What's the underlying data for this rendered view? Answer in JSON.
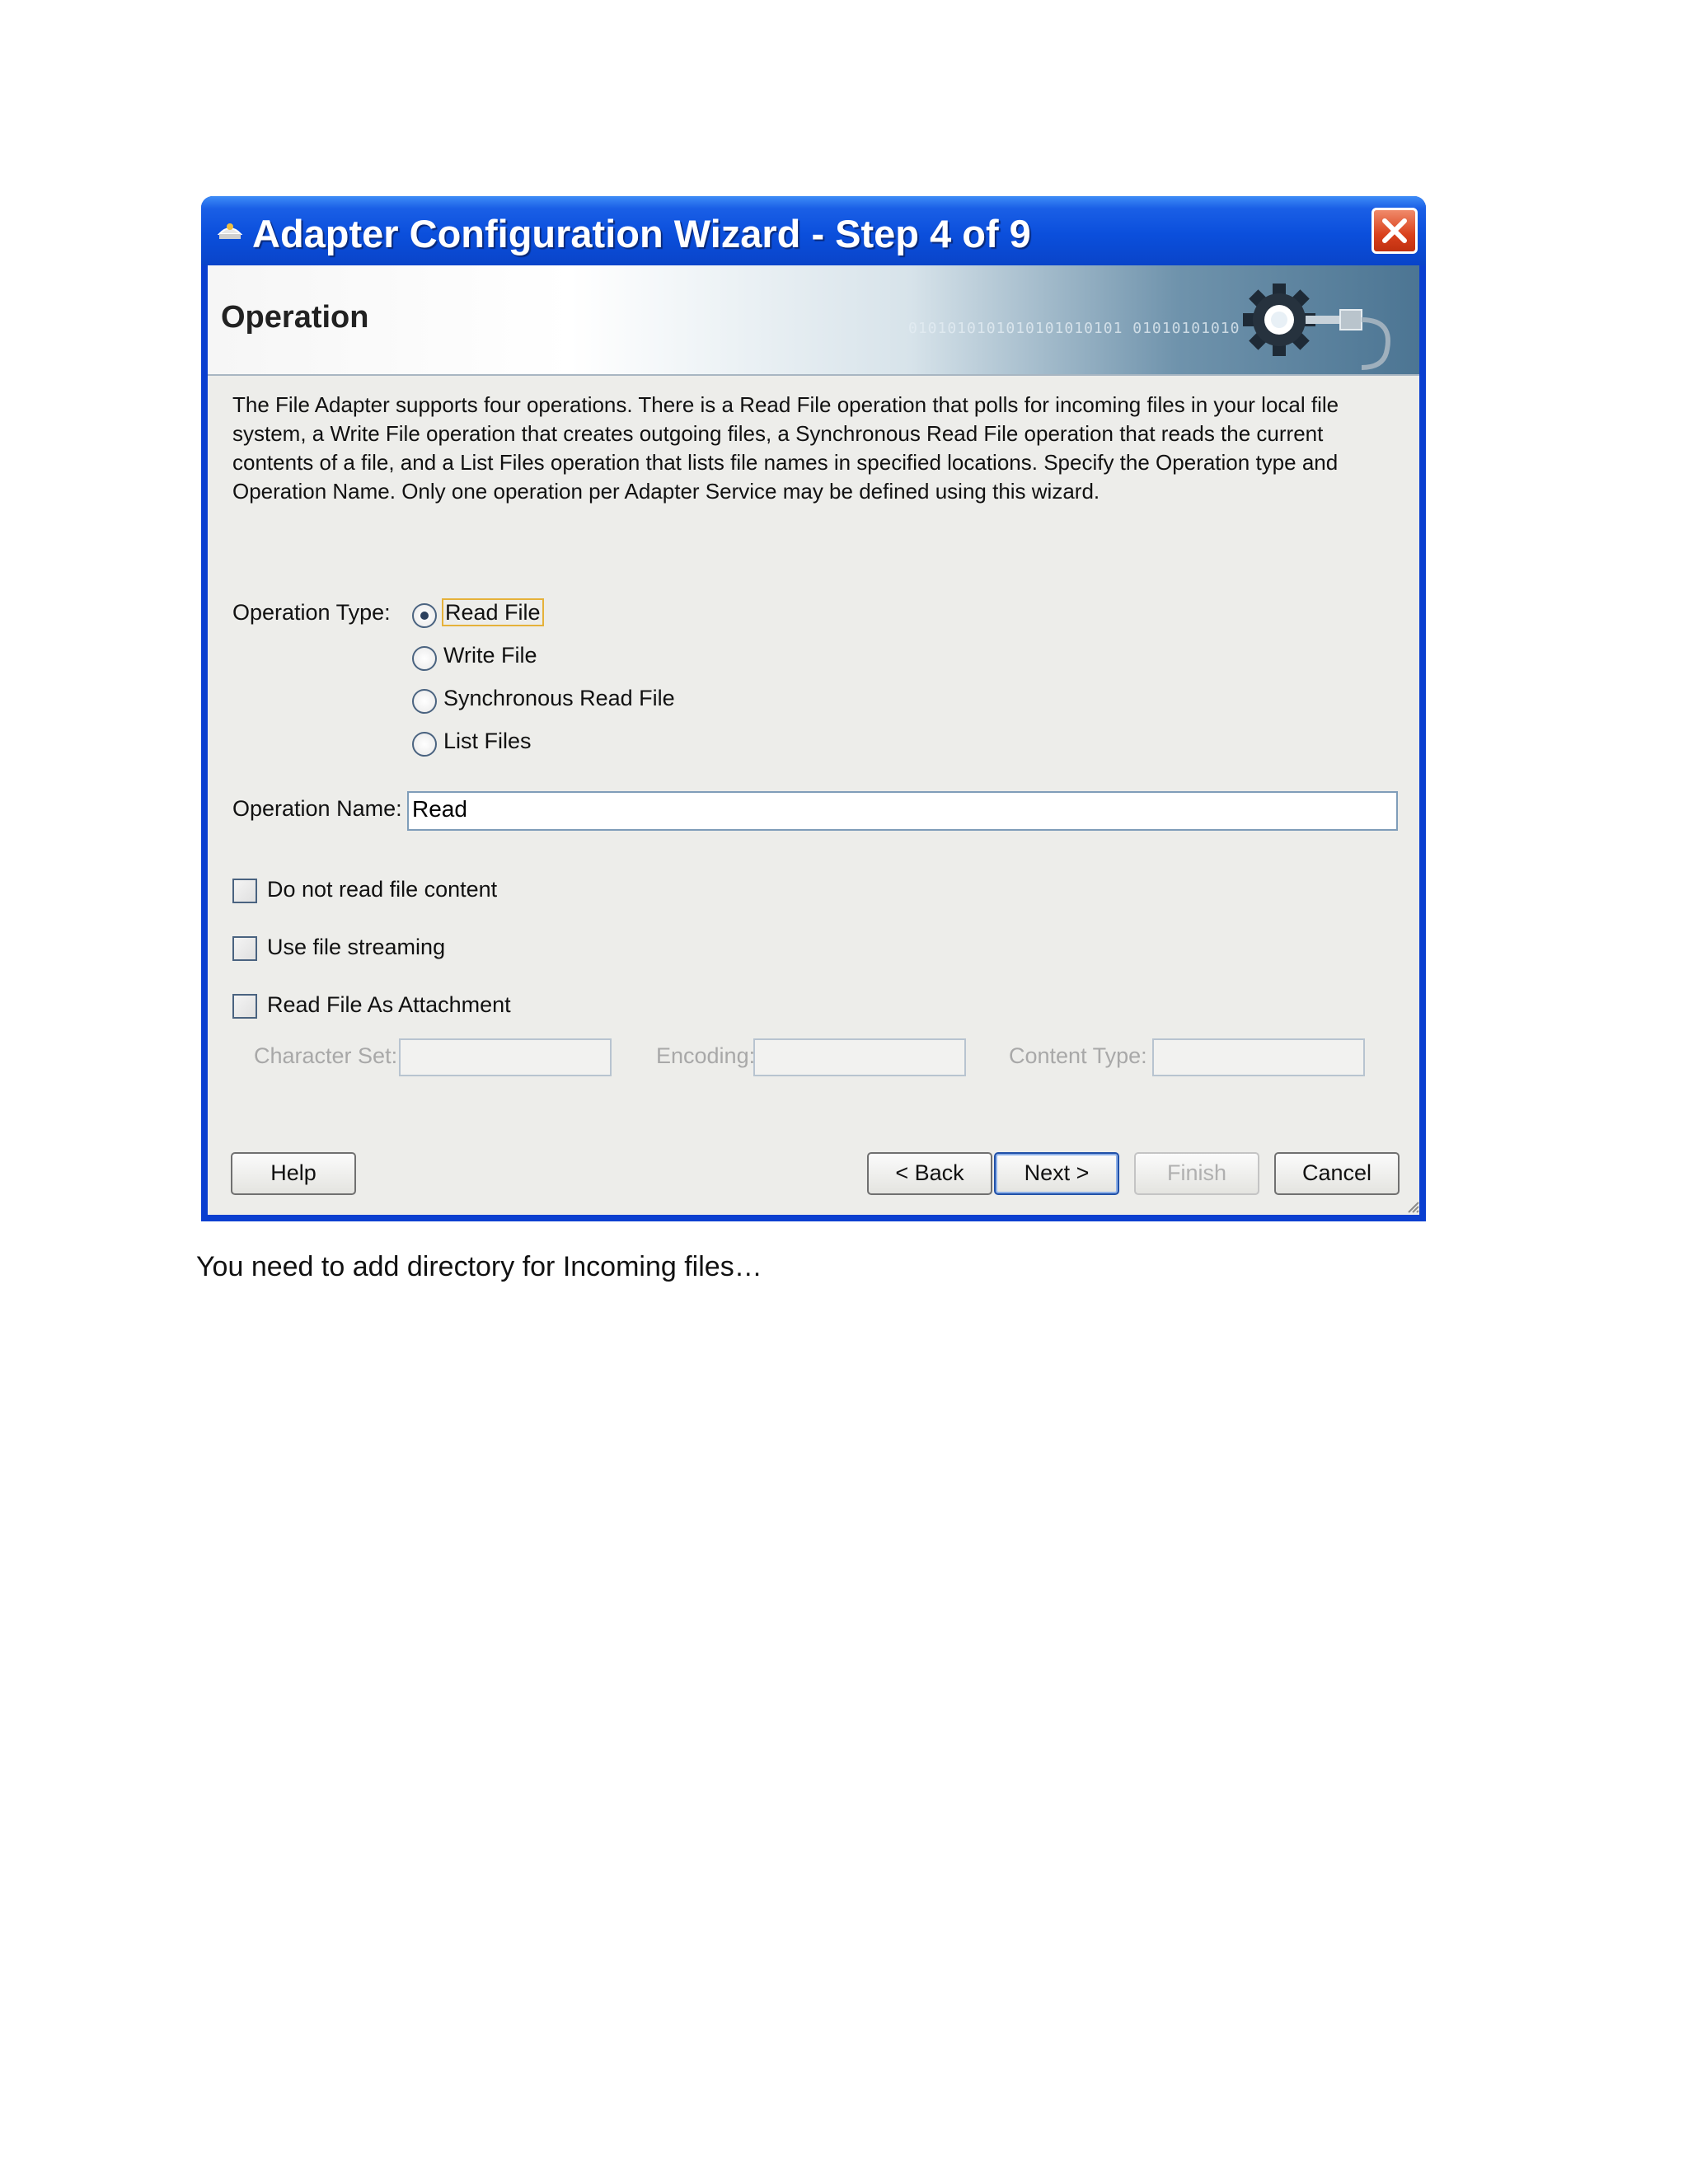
{
  "window": {
    "title": "Adapter Configuration Wizard - Step 4 of 9"
  },
  "banner": {
    "title": "Operation",
    "deco_text": "0101010101010101010101 01010101010"
  },
  "description": "The File Adapter supports four operations.  There is a Read File operation that polls for incoming files in your local file system, a Write File operation that creates outgoing files, a Synchronous Read File operation that reads the current contents of a file, and a List Files operation that lists file names in specified locations.  Specify the Operation type and Operation Name.  Only one operation per Adapter Service may be defined using this wizard.",
  "operation_type": {
    "label": "Operation Type:",
    "selected": "Read File",
    "options": [
      "Read File",
      "Write File",
      "Synchronous Read File",
      "List Files"
    ]
  },
  "operation_name": {
    "label": "Operation Name:",
    "value": "Read"
  },
  "checkboxes": [
    {
      "label": "Do not read file content",
      "checked": false
    },
    {
      "label": "Use file streaming",
      "checked": false
    },
    {
      "label": "Read File As Attachment",
      "checked": false
    }
  ],
  "attachment_fields": {
    "character_set_label": "Character Set:",
    "encoding_label": "Encoding:",
    "content_type_label": "Content Type:"
  },
  "buttons": {
    "help": "Help",
    "back": "< Back",
    "next": "Next >",
    "finish": "Finish",
    "cancel": "Cancel"
  },
  "caption": "You need to add  directory for Incoming files…"
}
